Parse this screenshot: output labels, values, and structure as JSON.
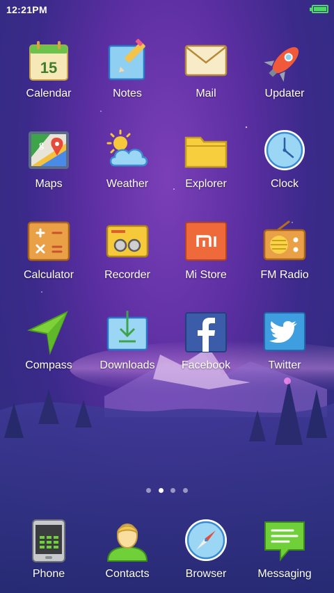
{
  "status": {
    "time": "12:21PM",
    "battery_icon": "battery-full-icon",
    "battery_color": "#4cd964"
  },
  "apps": [
    {
      "label": "Calendar",
      "icon": "calendar-icon",
      "calendar_day": "15"
    },
    {
      "label": "Notes",
      "icon": "notes-icon"
    },
    {
      "label": "Mail",
      "icon": "mail-icon"
    },
    {
      "label": "Updater",
      "icon": "rocket-icon"
    },
    {
      "label": "Maps",
      "icon": "maps-icon"
    },
    {
      "label": "Weather",
      "icon": "weather-icon"
    },
    {
      "label": "Explorer",
      "icon": "folder-icon"
    },
    {
      "label": "Clock",
      "icon": "clock-icon"
    },
    {
      "label": "Calculator",
      "icon": "calculator-icon"
    },
    {
      "label": "Recorder",
      "icon": "recorder-icon"
    },
    {
      "label": "Mi Store",
      "icon": "mi-store-icon"
    },
    {
      "label": "FM Radio",
      "icon": "radio-icon"
    },
    {
      "label": "Compass",
      "icon": "compass-icon"
    },
    {
      "label": "Downloads",
      "icon": "downloads-icon"
    },
    {
      "label": "Facebook",
      "icon": "facebook-icon"
    },
    {
      "label": "Twitter",
      "icon": "twitter-icon"
    }
  ],
  "pager": {
    "pages": 4,
    "current": 2
  },
  "dock": [
    {
      "label": "Phone",
      "icon": "phone-icon"
    },
    {
      "label": "Contacts",
      "icon": "contacts-icon"
    },
    {
      "label": "Browser",
      "icon": "browser-icon"
    },
    {
      "label": "Messaging",
      "icon": "messaging-icon"
    }
  ]
}
